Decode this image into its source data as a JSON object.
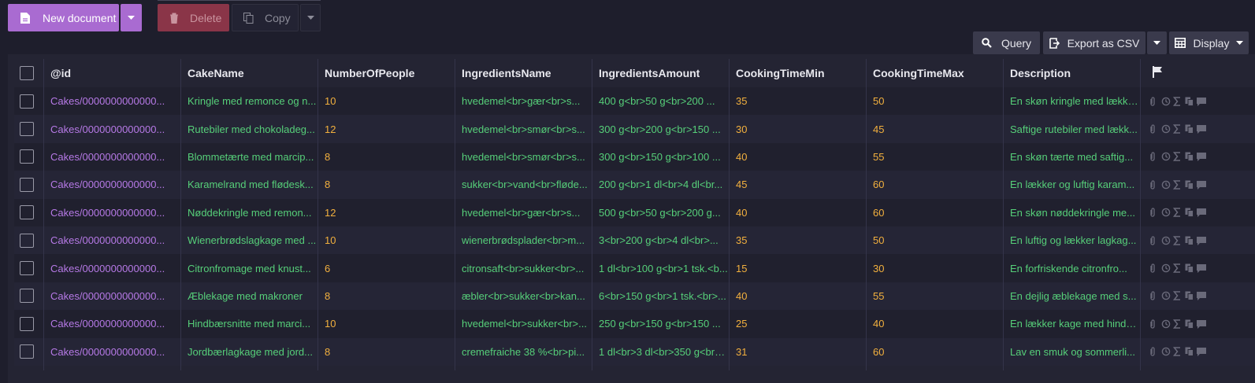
{
  "toolbar": {
    "new_document": "New document",
    "delete": "Delete",
    "copy": "Copy",
    "query": "Query",
    "export_csv": "Export as CSV",
    "display": "Display"
  },
  "columns": [
    "@id",
    "CakeName",
    "NumberOfPeople",
    "IngredientsName",
    "IngredientsAmount",
    "CookingTimeMin",
    "CookingTimeMax",
    "Description"
  ],
  "rows": [
    {
      "id": "Cakes/0000000000000...",
      "name": "Kringle med remonce og n...",
      "people": "10",
      "ing": "hvedemel<br>gær<br>s...",
      "amt": "400 g<br>50 g<br>200 ...",
      "tmin": "35",
      "tmax": "50",
      "desc": "En skøn kringle med lække..."
    },
    {
      "id": "Cakes/0000000000000...",
      "name": "Rutebiler med chokoladeg...",
      "people": "12",
      "ing": "hvedemel<br>smør<br>s...",
      "amt": "300 g<br>200 g<br>150 ...",
      "tmin": "30",
      "tmax": "45",
      "desc": "Saftige rutebiler med lækk..."
    },
    {
      "id": "Cakes/0000000000000...",
      "name": "Blommetærte med marcip...",
      "people": "8",
      "ing": "hvedemel<br>smør<br>s...",
      "amt": "300 g<br>150 g<br>100 ...",
      "tmin": "40",
      "tmax": "55",
      "desc": "En skøn tærte med saftig..."
    },
    {
      "id": "Cakes/0000000000000...",
      "name": "Karamelrand med flødesk...",
      "people": "8",
      "ing": "sukker<br>vand<br>fløde...",
      "amt": "200 g<br>1 dl<br>4 dl<br...",
      "tmin": "45",
      "tmax": "60",
      "desc": "En lækker og luftig karam..."
    },
    {
      "id": "Cakes/0000000000000...",
      "name": "Nøddekringle med remon...",
      "people": "12",
      "ing": "hvedemel<br>gær<br>s...",
      "amt": "500 g<br>50 g<br>200 g...",
      "tmin": "40",
      "tmax": "60",
      "desc": "En skøn nøddekringle me..."
    },
    {
      "id": "Cakes/0000000000000...",
      "name": "Wienerbrødslagkage med ...",
      "people": "10",
      "ing": "wienerbrødsplader<br>m...",
      "amt": "3<br>200 g<br>4 dl<br>...",
      "tmin": "35",
      "tmax": "50",
      "desc": "En luftig og lækker lagkag..."
    },
    {
      "id": "Cakes/0000000000000...",
      "name": "Citronfromage med knust...",
      "people": "6",
      "ing": "citronsaft<br>sukker<br>...",
      "amt": "1 dl<br>100 g<br>1 tsk.<b...",
      "tmin": "15",
      "tmax": "30",
      "desc": "En forfriskende citronfro..."
    },
    {
      "id": "Cakes/0000000000000...",
      "name": "Æblekage med makroner",
      "people": "8",
      "ing": "æbler<br>sukker<br>kan...",
      "amt": "6<br>150 g<br>1 tsk.<br>...",
      "tmin": "40",
      "tmax": "55",
      "desc": "En dejlig æblekage med s..."
    },
    {
      "id": "Cakes/0000000000000...",
      "name": "Hindbærsnitte med marci...",
      "people": "10",
      "ing": "hvedemel<br>sukker<br>...",
      "amt": "250 g<br>150 g<br>150 ...",
      "tmin": "25",
      "tmax": "40",
      "desc": "En lækker kage med hindb..."
    },
    {
      "id": "Cakes/0000000000000...",
      "name": "Jordbærlagkage med jord...",
      "people": "8",
      "ing": "cremefraiche 38 %<br>pi...",
      "amt": "1 dl<br>3 dl<br>350 g<br>...",
      "tmin": "31",
      "tmax": "60",
      "desc": "Lav en smuk og sommerli..."
    }
  ],
  "colors": {
    "accent": "#a96bd1",
    "id_text": "#b679e6",
    "string_text": "#56cf79",
    "number_text": "#f2b03e",
    "delete": "#8a3548"
  },
  "icons": [
    "file-icon",
    "trash-icon",
    "copy-icon",
    "search-icon",
    "export-icon",
    "table-icon",
    "flag-icon",
    "attachment-icon",
    "history-icon",
    "sigma-icon",
    "revisions-icon",
    "comment-icon"
  ]
}
